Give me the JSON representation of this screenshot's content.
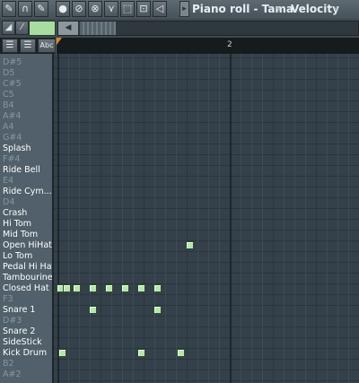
{
  "toolbar": {
    "title": "Piano roll - Tama",
    "title_caret": "▾",
    "velocity_label": "Velocity",
    "velocity_caret": "▾",
    "menu_arrow": "▸",
    "tools": [
      {
        "name": "wrench-icon",
        "glyph": "✎"
      },
      {
        "name": "magnet-icon",
        "glyph": "∩"
      },
      {
        "name": "pencil-tool-icon",
        "glyph": "✎"
      },
      {
        "name": "paint-tool-icon",
        "glyph": "●"
      },
      {
        "name": "delete-tool-icon",
        "glyph": "⊘"
      },
      {
        "name": "mute-tool-icon",
        "glyph": "⊗"
      },
      {
        "name": "slice-tool-icon",
        "glyph": "⋎"
      },
      {
        "name": "select-tool-icon",
        "glyph": "⬚"
      },
      {
        "name": "zoom-tool-icon",
        "glyph": "⊡"
      },
      {
        "name": "playback-tool-icon",
        "glyph": "◁"
      }
    ]
  },
  "row2": {
    "left_buttons": [
      {
        "name": "fill-icon",
        "glyph": "◢"
      },
      {
        "name": "line-icon",
        "glyph": "⁄"
      }
    ],
    "scroll_left_glyph": "◀",
    "accent_color": "#a8dca0"
  },
  "row3": {
    "buttons": [
      {
        "name": "chord-icon",
        "glyph": "☰"
      },
      {
        "name": "scale-icon",
        "glyph": "☰"
      }
    ],
    "abc_label": "Abc"
  },
  "timeline": {
    "bar_number": "2"
  },
  "keys": [
    {
      "label": "D#5",
      "named": false
    },
    {
      "label": "D5",
      "named": false
    },
    {
      "label": "C#5",
      "named": false
    },
    {
      "label": "C5",
      "named": false
    },
    {
      "label": "B4",
      "named": false
    },
    {
      "label": "A#4",
      "named": false
    },
    {
      "label": "A4",
      "named": false
    },
    {
      "label": "G#4",
      "named": false
    },
    {
      "label": "Splash",
      "named": true
    },
    {
      "label": "F#4",
      "named": false
    },
    {
      "label": "Ride Bell",
      "named": true
    },
    {
      "label": "E4",
      "named": false
    },
    {
      "label": "Ride Cym...",
      "named": true
    },
    {
      "label": "D4",
      "named": false
    },
    {
      "label": "Crash",
      "named": true
    },
    {
      "label": "Hi Tom",
      "named": true
    },
    {
      "label": "Mid Tom",
      "named": true
    },
    {
      "label": "Open HiHat",
      "named": true
    },
    {
      "label": "Lo Tom",
      "named": true
    },
    {
      "label": "Pedal Hi Hat",
      "named": true
    },
    {
      "label": "Tambourine",
      "named": true
    },
    {
      "label": "Closed Hat",
      "named": true
    },
    {
      "label": "F3",
      "named": false
    },
    {
      "label": "Snare 1",
      "named": true
    },
    {
      "label": "D#3",
      "named": false
    },
    {
      "label": "Snare 2",
      "named": true
    },
    {
      "label": "SideStick",
      "named": true
    },
    {
      "label": "Kick Drum",
      "named": true
    },
    {
      "label": "B2",
      "named": false
    },
    {
      "label": "A#2",
      "named": false
    }
  ],
  "notes": [
    {
      "row": 17,
      "step": 12
    },
    {
      "row": 21,
      "step": 0
    },
    {
      "row": 21,
      "step": 0.6
    },
    {
      "row": 21,
      "step": 1.5
    },
    {
      "row": 21,
      "step": 3
    },
    {
      "row": 21,
      "step": 4.5
    },
    {
      "row": 21,
      "step": 6
    },
    {
      "row": 21,
      "step": 7.5
    },
    {
      "row": 21,
      "step": 9
    },
    {
      "row": 23,
      "step": 3
    },
    {
      "row": 23,
      "step": 9
    },
    {
      "row": 27,
      "step": 0.2
    },
    {
      "row": 27,
      "step": 7.5
    },
    {
      "row": 27,
      "step": 11.2
    }
  ]
}
